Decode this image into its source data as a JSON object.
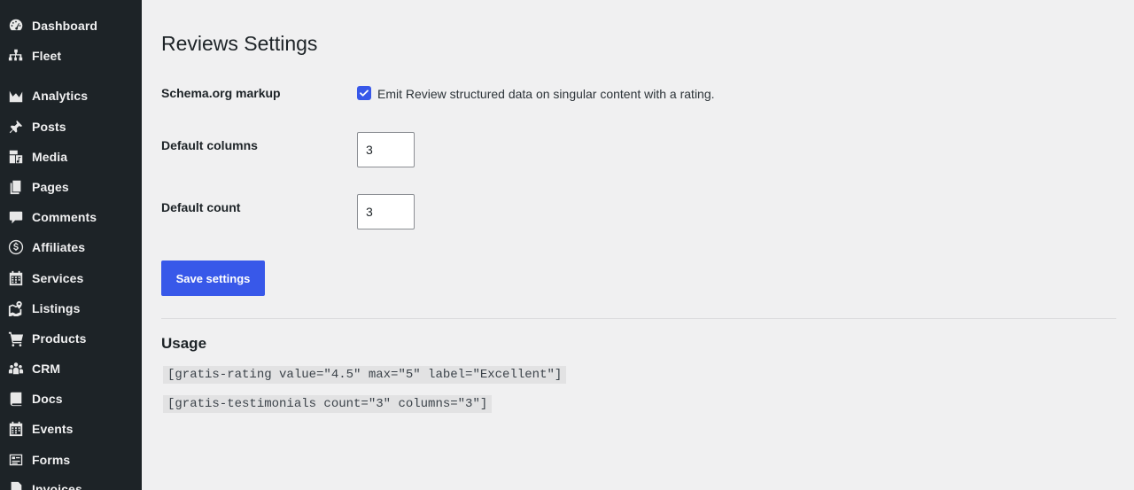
{
  "sidebar": {
    "items": [
      {
        "label": "Dashboard",
        "icon": "dashboard-icon"
      },
      {
        "label": "Fleet",
        "icon": "sitemap-icon"
      },
      {
        "label": "Analytics",
        "icon": "chart-area-icon"
      },
      {
        "label": "Posts",
        "icon": "pin-icon"
      },
      {
        "label": "Media",
        "icon": "media-icon"
      },
      {
        "label": "Pages",
        "icon": "pages-icon"
      },
      {
        "label": "Comments",
        "icon": "comment-icon"
      },
      {
        "label": "Affiliates",
        "icon": "dollar-icon"
      },
      {
        "label": "Services",
        "icon": "calendar-icon"
      },
      {
        "label": "Listings",
        "icon": "map-icon"
      },
      {
        "label": "Products",
        "icon": "cart-icon"
      },
      {
        "label": "CRM",
        "icon": "groups-icon"
      },
      {
        "label": "Docs",
        "icon": "book-icon"
      },
      {
        "label": "Events",
        "icon": "calendar-alt-icon"
      },
      {
        "label": "Forms",
        "icon": "forms-icon"
      },
      {
        "label": "Invoices",
        "icon": "invoice-icon"
      }
    ]
  },
  "main": {
    "title": "Reviews Settings",
    "schema": {
      "label": "Schema.org markup",
      "checked": true,
      "description": "Emit Review structured data on singular content with a rating."
    },
    "columns": {
      "label": "Default columns",
      "value": "3"
    },
    "count": {
      "label": "Default count",
      "value": "3"
    },
    "save_label": "Save settings",
    "usage": {
      "title": "Usage",
      "snippets": [
        "[gratis-rating value=\"4.5\" max=\"5\" label=\"Excellent\"]",
        "[gratis-testimonials count=\"3\" columns=\"3\"]"
      ]
    }
  },
  "colors": {
    "sidebar_bg": "#1d2327",
    "page_bg": "#f0f0f1",
    "accent": "#3858e9"
  }
}
